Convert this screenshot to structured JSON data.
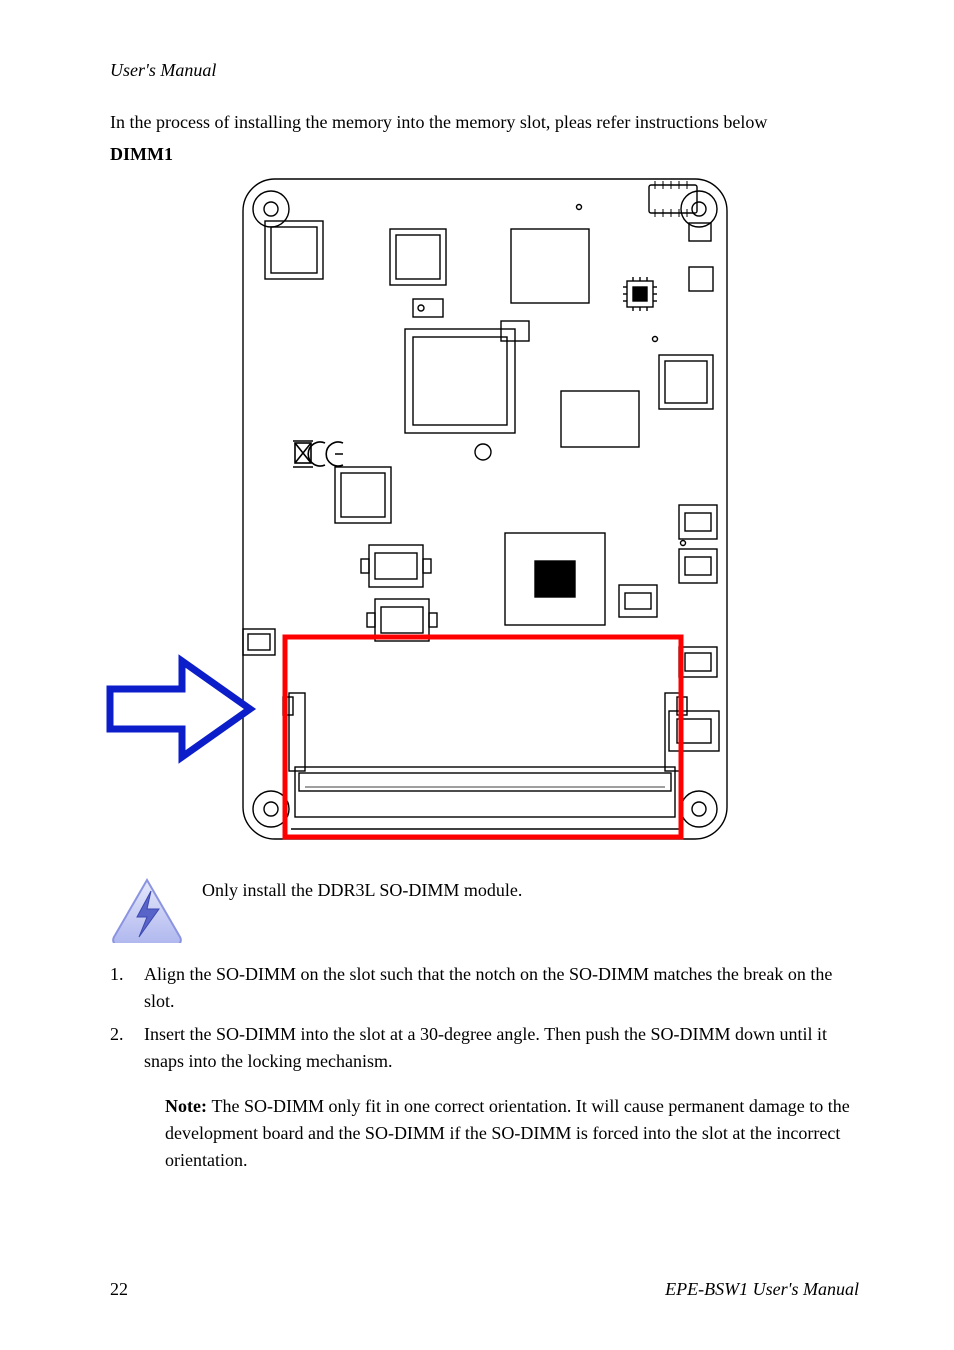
{
  "header": {
    "title_left": "User's Manual",
    "title_right": ""
  },
  "intro_text": "In the process of installing the memory into the memory slot, pleas refer instructions below",
  "dimm_label": "DIMM1",
  "warning_text": "Only install the DDR3L SO-DIMM module.",
  "steps": {
    "step1_num": "1.",
    "step1_text": "Align the SO-DIMM on the slot such that the notch on the SO-DIMM matches the break on the slot.",
    "step2_num": "2.",
    "step2_text": "Insert the SO-DIMM into the slot at a 30-degree angle. Then push the SO-DIMM down until it snaps into the locking mechanism."
  },
  "note_label": "Note: ",
  "note_text": "The SO-DIMM only fit in one correct orientation. It will cause permanent damage to the development board and the SO-DIMM if the SO-DIMM is forced into the slot at the incorrect orientation.",
  "footer": {
    "left": "22",
    "right": "EPE-BSW1 User's Manual"
  },
  "icons": {
    "arrow": "arrow-right-icon",
    "warning": "esd-warning-icon",
    "board": "pcb-diagram"
  },
  "colors": {
    "highlight_box": "#ff0000",
    "arrow_stroke": "#0b1ec9",
    "warning_fill": "#b9c1f0",
    "warning_line": "#6a77d6"
  }
}
